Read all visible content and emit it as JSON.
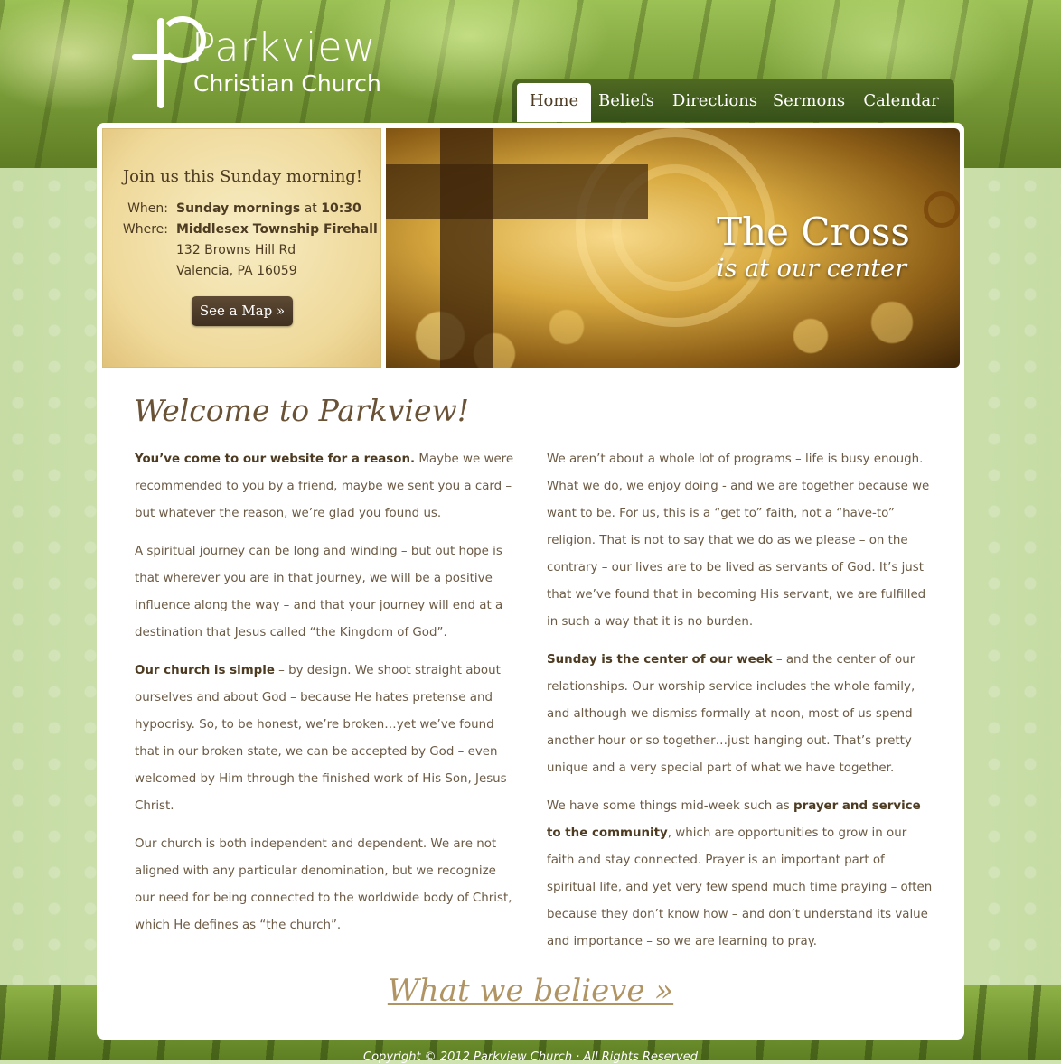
{
  "site": {
    "name": "Parkview",
    "subtitle": "Christian Church"
  },
  "nav": {
    "items": [
      {
        "label": "Home",
        "active": true
      },
      {
        "label": "Beliefs",
        "active": false
      },
      {
        "label": "Directions",
        "active": false
      },
      {
        "label": "Sermons",
        "active": false
      },
      {
        "label": "Calendar",
        "active": false
      }
    ]
  },
  "join": {
    "title": "Join us this Sunday morning!",
    "when_label": "When:",
    "when_bold": "Sunday mornings",
    "when_at": " at ",
    "when_time": "10:30",
    "where_label": "Where:",
    "where_place": "Middlesex Township Firehall",
    "address_line1": "132 Browns Hill Rd",
    "address_line2": "Valencia, PA 16059",
    "map_button": "See a Map »"
  },
  "hero": {
    "title": "The Cross",
    "subtitle": "is at our center"
  },
  "content": {
    "heading": "Welcome to Parkview!",
    "left": [
      {
        "bold": "You’ve come to our website for a reason.",
        "text": "  Maybe we were recommended to you by a friend, maybe we sent you a card – but whatever the reason, we’re glad you found us."
      },
      {
        "bold": "",
        "text": "A spiritual journey can be long and winding – but out hope is that wherever you are in that journey, we will be a positive influence along the way – and that your journey will end at a destination that Jesus called “the Kingdom of God”."
      },
      {
        "bold": "Our church is simple",
        "text": " – by design.  We shoot straight about ourselves and about God – because He hates pretense and hypocrisy.  So, to be honest, we’re broken…yet we’ve found that in our broken state, we can be accepted by God – even welcomed by Him through the finished work of His Son, Jesus Christ."
      },
      {
        "bold": "",
        "text": "Our church is both independent and dependent.  We are not aligned with any particular denomination, but we recognize our need for being connected to the worldwide body of Christ, which He defines as “the church”."
      }
    ],
    "right": [
      {
        "bold": "",
        "text": "We aren’t about a whole lot of programs – life is busy enough.  What we do, we enjoy doing - and we are together because we want to be.  For us, this is a “get to” faith, not a “have-to” religion.  That is not to say that we do as we please – on the contrary – our lives are to be lived as servants of God.  It’s just that we’ve found that in becoming His servant, we are fulfilled in such a way that it is no burden."
      },
      {
        "bold": "Sunday is the center of our week",
        "text": " – and the center of our relationships.  Our worship service includes the whole family, and although we dismiss formally at noon, most of us spend another hour or so together…just hanging out.  That’s pretty unique and a very special part of what we have together."
      },
      {
        "pre": "We have some things mid-week such as ",
        "bold": "prayer and service to the community",
        "text": ", which are opportunities to grow in our faith and stay connected.  Prayer is an important part of spiritual life, and yet very few spend much time praying – often because they don’t know how – and don’t understand its value and importance – so we are learning to pray."
      }
    ],
    "believe_link": "What we believe »"
  },
  "footer": {
    "text": "Copyright © 2012 Parkview Church  ·  All Rights Reserved"
  },
  "colors": {
    "brand_brown": "#4d3b22",
    "nav_green": "#3f5a1e",
    "link_tan": "#b09463"
  }
}
